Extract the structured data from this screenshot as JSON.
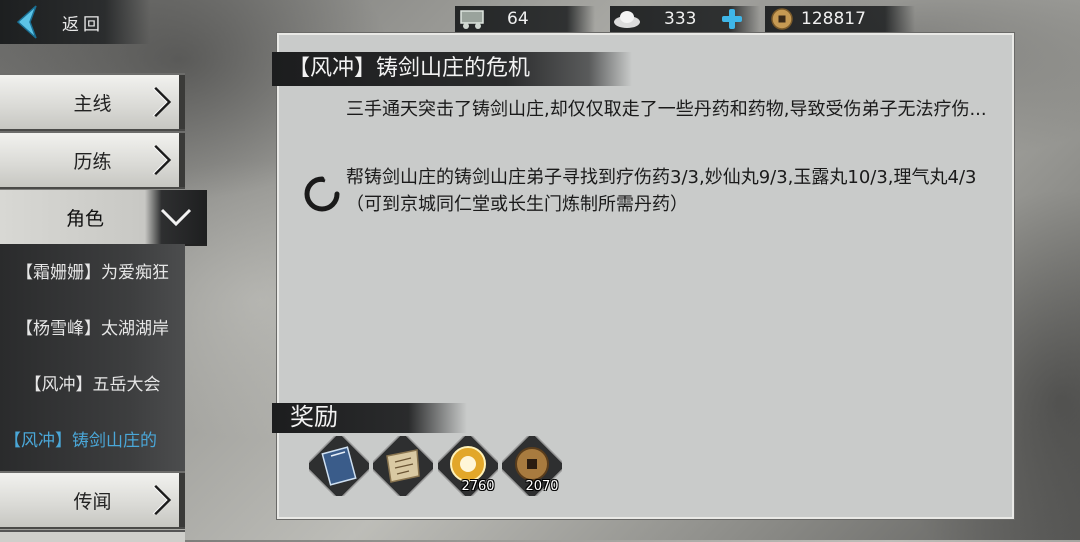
{
  "header": {
    "back_label": "返回",
    "resources": [
      {
        "icon": "stamina-cart-icon",
        "value": "64"
      },
      {
        "icon": "silver-ingot-icon",
        "value": "333"
      },
      {
        "icon": "copper-coin-icon",
        "value": "128817"
      }
    ],
    "accent": "#4aa7d8"
  },
  "menu": {
    "items": [
      {
        "label": "主线"
      },
      {
        "label": "历练"
      },
      {
        "label": "角色"
      },
      {
        "label": "传闻"
      }
    ],
    "sub_items": [
      {
        "label": "【霜姗姗】为爱痴狂"
      },
      {
        "label": "【杨雪峰】太湖湖岸"
      },
      {
        "label": "【风冲】五岳大会"
      },
      {
        "label": "【风冲】铸剑山庄的"
      }
    ]
  },
  "quest": {
    "title": "【风冲】铸剑山庄的危机",
    "description": "三手通天突击了铸剑山庄,却仅仅取走了一些丹药和药物,导致受伤弟子无法疗伤...",
    "task": "帮铸剑山庄的铸剑山庄弟子寻找到疗伤药3/3,妙仙丸9/3,玉露丸10/3,理气丸4/3（可到京城同仁堂或长生门炼制所需丹药）",
    "status_icon": "in-progress-spinner-icon"
  },
  "rewards": {
    "title": "奖励",
    "items": [
      {
        "icon": "book-icon",
        "count": ""
      },
      {
        "icon": "scroll-icon",
        "count": ""
      },
      {
        "icon": "gold-medal-icon",
        "count": "2760"
      },
      {
        "icon": "coin-icon",
        "count": "2070"
      }
    ]
  }
}
